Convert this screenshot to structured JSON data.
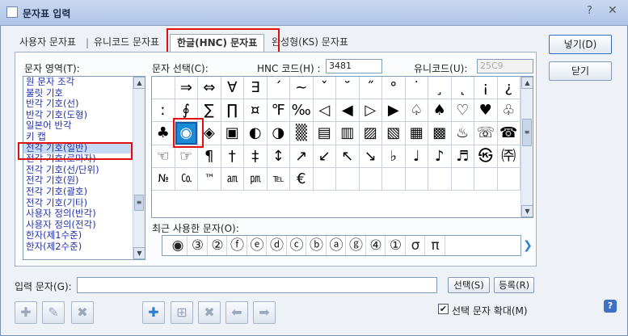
{
  "window": {
    "title": "문자표 입력",
    "help": "?",
    "close": "✕"
  },
  "tabs": [
    {
      "label": "사용자 문자표"
    },
    {
      "label": "유니코드 문자표"
    },
    {
      "label": "한글(HNC) 문자표"
    },
    {
      "label": "완성형(KS) 문자표"
    }
  ],
  "area": {
    "label": "문자 영역(T):",
    "items": [
      "원 문자 조각",
      "불릿 기호",
      "반각 기호(선)",
      "반각 기호(도형)",
      "일본어 반각",
      "키 캡",
      "전각 기호(일반)",
      "전각 기호(로마자)",
      "전각 기호(선/단위)",
      "전각 기호(원)",
      "전각 기호(괄호)",
      "전각 기호(기타)",
      "사용자 정의(반각)",
      "사용자 정의(전각)",
      "한자(제1수준)",
      "한자(제2수준)"
    ],
    "selected_index": 6
  },
  "char_select": {
    "label": "문자 선택(C):",
    "hnc_label": "HNC 코드(H) :",
    "hnc_value": "3481",
    "unicode_label": "유니코드(U):",
    "unicode_value": "25C9"
  },
  "grid": [
    [
      "",
      "⇒",
      "⇔",
      "∀",
      "∃",
      "´",
      "~",
      "ˇ",
      "˘",
      "˝",
      "°",
      "˙",
      "¸",
      "˛",
      "¡",
      "¿"
    ],
    [
      "ː",
      "∮",
      "∑",
      "∏",
      "¤",
      "℉",
      "‰",
      "◁",
      "◀",
      "▷",
      "▶",
      "♤",
      "♠",
      "♡",
      "♥",
      "♧"
    ],
    [
      "♣",
      "◉",
      "◈",
      "▣",
      "◐",
      "◑",
      "▒",
      "▤",
      "▥",
      "▨",
      "▧",
      "▦",
      "▩",
      "♨",
      "☏",
      "☎"
    ],
    [
      "☜",
      "☞",
      "¶",
      "†",
      "‡",
      "↕",
      "↗",
      "↙",
      "↖",
      "↘",
      "♭",
      "♩",
      "♪",
      "♬",
      "㉿",
      "㈜"
    ],
    [
      "№",
      "㏇",
      "™",
      "㏂",
      "㏘",
      "℡",
      "€",
      "",
      "",
      "",
      "",
      "",
      "",
      "",
      "",
      ""
    ]
  ],
  "selected_cell": [
    2,
    1
  ],
  "recent": {
    "label": "최근 사용한 문자(O):",
    "items": [
      "◉",
      "③",
      "②",
      "ⓕ",
      "ⓔ",
      "ⓓ",
      "ⓒ",
      "ⓑ",
      "ⓐ",
      "ⓖ",
      "④",
      "①",
      "σ",
      "π"
    ]
  },
  "input": {
    "label": "입력 문자(G):",
    "value": ""
  },
  "buttons": {
    "insert": "넣기(D)",
    "close": "닫기",
    "select": "선택(S)",
    "register": "등록(R)"
  },
  "checkbox": {
    "label": "선택 문자 확대(M)",
    "checked": true
  }
}
